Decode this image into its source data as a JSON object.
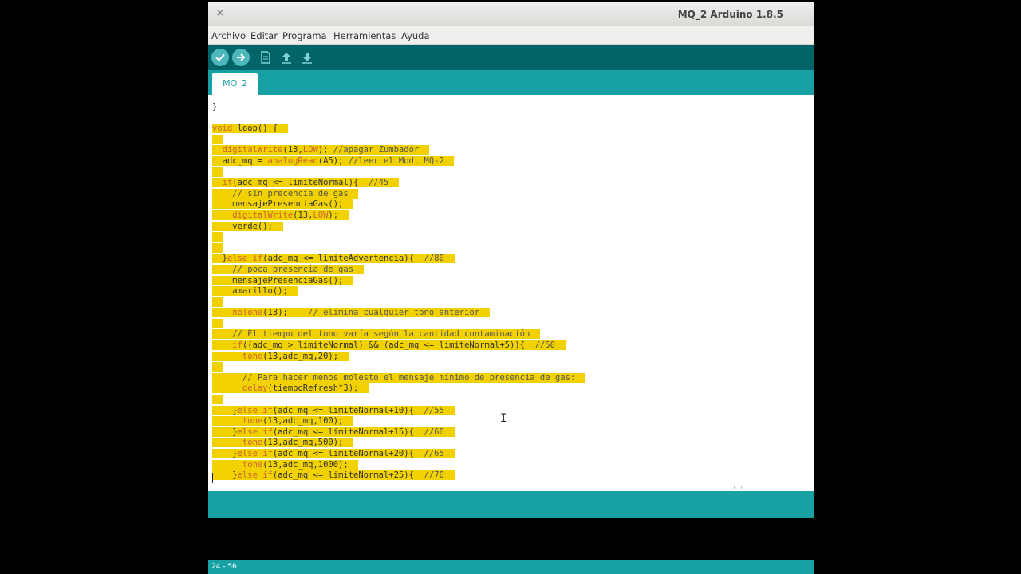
{
  "window": {
    "title": "MQ_2 Arduino 1.8.5",
    "close_glyph": "×"
  },
  "menu": [
    {
      "label": "Archivo"
    },
    {
      "label": "Editar"
    },
    {
      "label": "Programa"
    },
    {
      "label": "Herramientas"
    },
    {
      "label": "Ayuda"
    }
  ],
  "toolbar": [
    {
      "name": "verify-button",
      "icon": "check-icon"
    },
    {
      "name": "upload-button",
      "icon": "arrow-right-icon"
    },
    {
      "name": "new-button",
      "icon": "new-file-icon"
    },
    {
      "name": "open-button",
      "icon": "open-arrow-up-icon"
    },
    {
      "name": "save-button",
      "icon": "save-arrow-down-icon"
    }
  ],
  "tab": {
    "label": "MQ_2"
  },
  "code_lines": [
    "}",
    "",
    "void loop() {",
    "",
    "  digitalWrite(13,LOW); //apagar Zumbador",
    "  adc_mq = analogRead(A5); //leer el Mod. MQ-2",
    "",
    "  if(adc_mq <= limiteNormal){  //45",
    "    // sin precencia de gas",
    "    mensajePresenciaGas();",
    "    digitalWrite(13,LOW);",
    "    verde();",
    "",
    "",
    "  }else if(adc_mq <= limiteAdvertencia){  //80",
    "    // poca presencia de gas",
    "    mensajePresenciaGas();",
    "    amarillo();",
    "",
    "    noTone(13);    // elimina cualquier tono anterior",
    "",
    "    // El tiempo del tono varía según la cantidad contaminación",
    "    if((adc_mq > limiteNormal) && (adc_mq <= limiteNormal+5)){  //50",
    "      tone(13,adc_mq,20);",
    "",
    "      // Para hacer menos molesto el mensaje mínimo de presencia de gas:",
    "      delay(tiempoRefresh*3);",
    "",
    "    }else if(adc_mq <= limiteNormal+10){  //55",
    "      tone(13,adc_mq,100);",
    "    }else if(adc_mq <= limiteNormal+15){  //60",
    "      tone(13,adc_mq,500);",
    "    }else if(adc_mq <= limiteNormal+20){  //65",
    "      tone(13,adc_mq,1000);",
    "    }else if(adc_mq <= limiteNormal+25){  //70"
  ],
  "status": {
    "text": "24 - 56"
  },
  "colors": {
    "toolbar": "#006468",
    "tabbar": "#17a1a5",
    "selection": "#f1d100"
  }
}
